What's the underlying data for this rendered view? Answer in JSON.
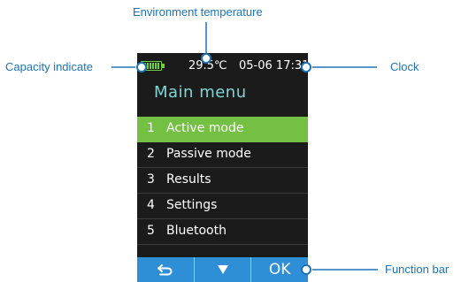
{
  "callouts": {
    "environment_temperature": "Environment temperature",
    "capacity_indicate": "Capacity indicate",
    "clock": "Clock",
    "function_bar": "Function bar"
  },
  "device": {
    "status_bar": {
      "battery_icon": "battery-full-icon",
      "temperature": "29.5℃",
      "date": "05-06",
      "time": "17:31"
    },
    "title": "Main  menu",
    "menu_items": [
      {
        "number": "1",
        "label": "Active mode",
        "selected": true
      },
      {
        "number": "2",
        "label": "Passive mode",
        "selected": false
      },
      {
        "number": "3",
        "label": "Results",
        "selected": false
      },
      {
        "number": "4",
        "label": "Settings",
        "selected": false
      },
      {
        "number": "5",
        "label": "Bluetooth",
        "selected": false
      }
    ],
    "function_bar": {
      "back_icon": "back-arrow-icon",
      "down_icon": "down-triangle-icon",
      "ok_label": "OK"
    }
  },
  "colors": {
    "callout_text": "#1e73b8",
    "screen_background": "#1b1b1b",
    "selected_item": "#74c043",
    "title_text": "#7fd6d4",
    "function_bar": "#2f8fd6",
    "battery": "#6ed13c"
  }
}
